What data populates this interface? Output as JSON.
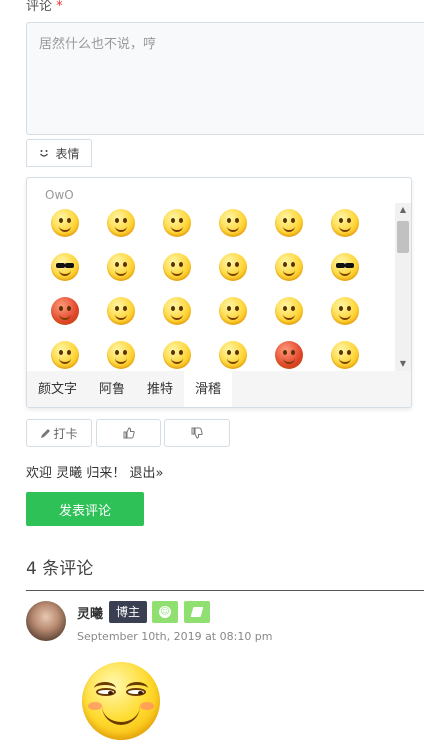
{
  "form": {
    "label": "评论",
    "required_mark": "*",
    "textarea_placeholder": "居然什么也不说，哼",
    "emoji_toggle_icon": "emoticon-face-icon",
    "emoji_toggle_label": "表情"
  },
  "owo": {
    "title": "OwO",
    "packages": [
      "颜文字",
      "阿鲁",
      "推特",
      "滑稽"
    ],
    "active_package": "滑稽",
    "emoji_count_visible": 24
  },
  "actions": {
    "punch_label": "打卡",
    "punch_icon": "pencil-icon",
    "like_icon": "thumbs-up-icon",
    "dislike_icon": "thumbs-down-icon"
  },
  "welcome": {
    "prefix": "欢迎",
    "name": "灵曦",
    "suffix": "归来！",
    "logout": "退出»"
  },
  "submit_label": "发表评论",
  "comments": {
    "count_text": "4 条评论",
    "items": [
      {
        "author": "灵曦",
        "badge": "博主",
        "date": "September 10th, 2019 at 08:10 pm",
        "content_icon": "huaji-smirk-emoji"
      }
    ]
  },
  "colors": {
    "submit": "#2ec157",
    "badge_dark": "#3b3f52",
    "badge_green": "#8fe071",
    "required": "#e33333"
  }
}
